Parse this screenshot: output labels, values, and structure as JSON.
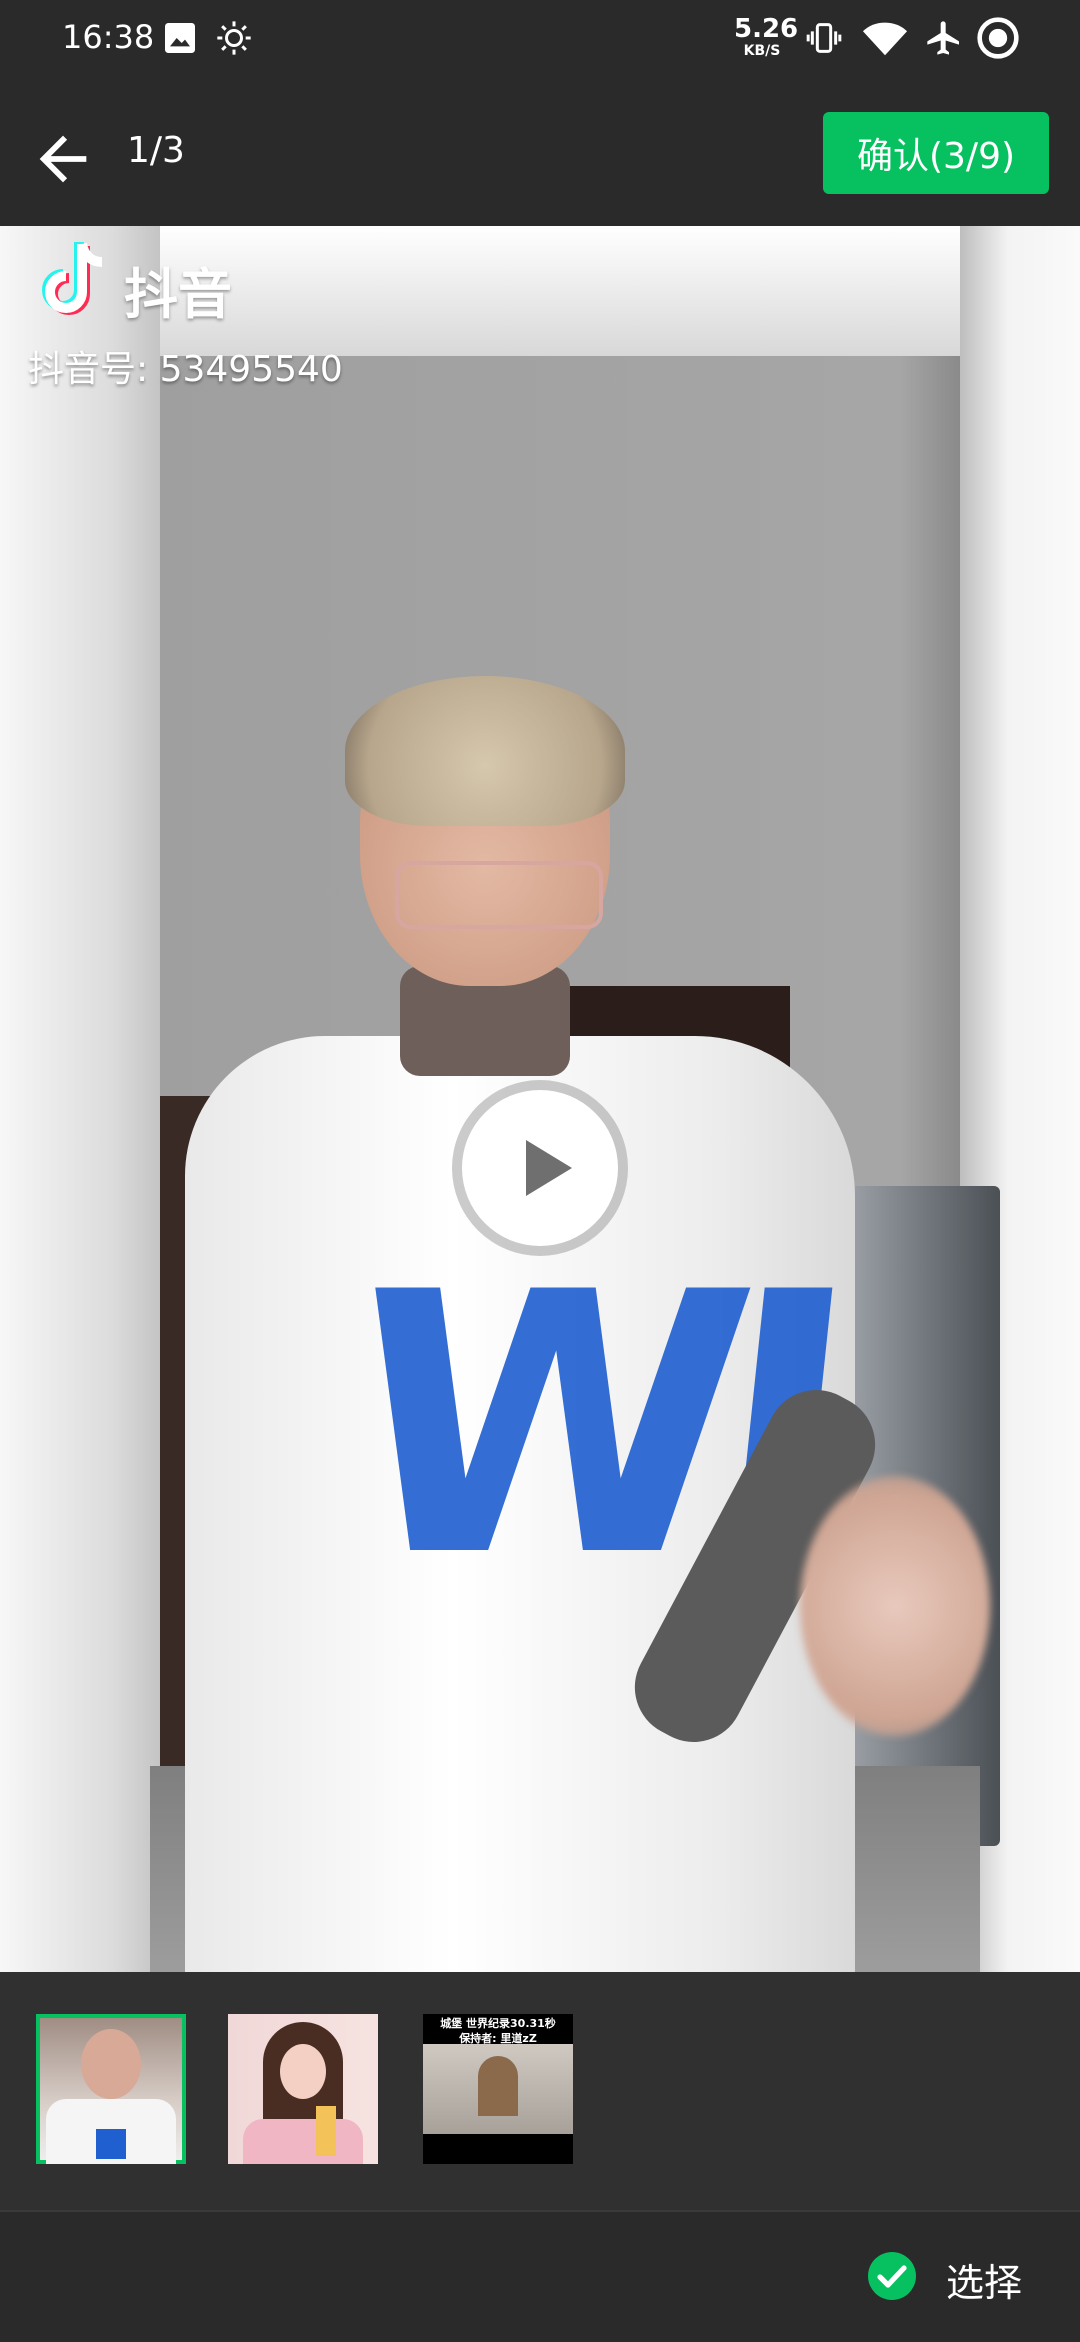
{
  "status_bar": {
    "time": "16:38",
    "net_speed_value": "5.26",
    "net_speed_unit": "KB/S",
    "icons": [
      "image-icon",
      "brightness-icon",
      "vibrate-icon",
      "wifi-icon",
      "airplane-icon",
      "record-icon"
    ]
  },
  "top_bar": {
    "page_indicator": "1/3",
    "confirm_label": "确认(3/9)"
  },
  "preview": {
    "app_name": "抖音",
    "account_id": "抖音号: 53495540",
    "shirt_text": "WI"
  },
  "thumbnails": {
    "third_caption_line1": "城堡 世界纪录30.31秒",
    "third_caption_line2": "保持者: 里道zZ"
  },
  "bottom_bar": {
    "select_label": "选择"
  },
  "colors": {
    "accent": "#07c160",
    "background": "#2a2a2a"
  }
}
